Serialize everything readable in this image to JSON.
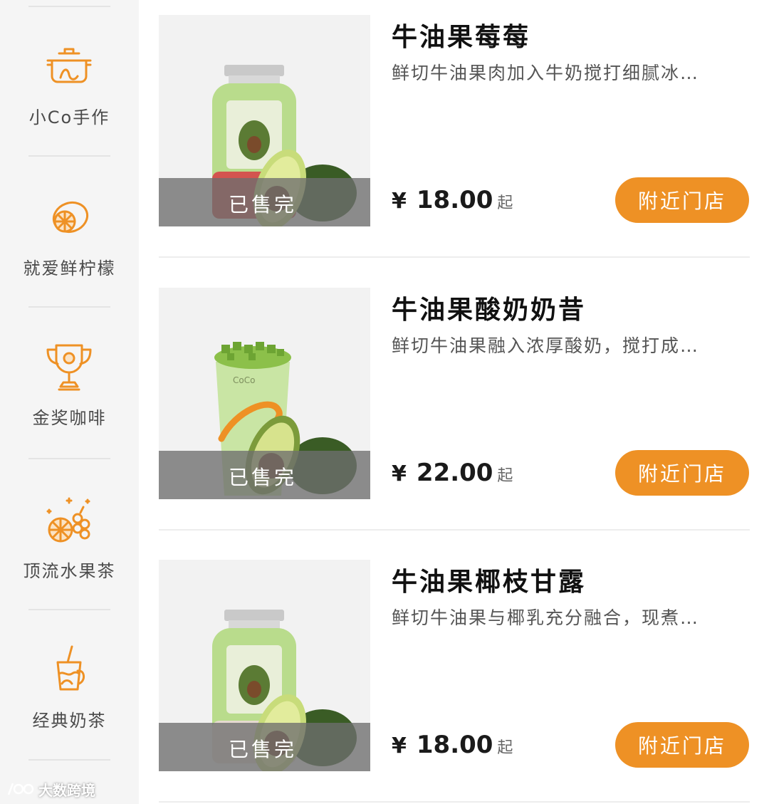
{
  "colors": {
    "accent": "#ee9125",
    "sidebar_bg": "#f5f5f5",
    "soldout_overlay": "#6e6e6e"
  },
  "sidebar": {
    "items": [
      {
        "label": "小Co手作",
        "icon": "pot-icon"
      },
      {
        "label": "就爱鲜柠檬",
        "icon": "lemon-icon"
      },
      {
        "label": "金奖咖啡",
        "icon": "trophy-icon"
      },
      {
        "label": "顶流水果茶",
        "icon": "fruit-icon"
      },
      {
        "label": "经典奶茶",
        "icon": "milk-tea-cup-icon"
      }
    ]
  },
  "watermark": "大数跨境",
  "products": [
    {
      "title": "牛油果莓莓",
      "desc": "鲜切牛油果肉加入牛奶搅打细腻冰…",
      "currency": "¥",
      "price": "18.00",
      "price_suffix": "起",
      "soldout_label": "已售完",
      "button_label": "附近门店",
      "image": "avocado-bottle"
    },
    {
      "title": "牛油果酸奶奶昔",
      "desc": "鲜切牛油果融入浓厚酸奶，搅打成…",
      "currency": "¥",
      "price": "22.00",
      "price_suffix": "起",
      "soldout_label": "已售完",
      "button_label": "附近门店",
      "image": "avocado-cup"
    },
    {
      "title": "牛油果椰枝甘露",
      "desc": "鲜切牛油果与椰乳充分融合，现煮…",
      "currency": "¥",
      "price": "18.00",
      "price_suffix": "起",
      "soldout_label": "已售完",
      "button_label": "附近门店",
      "image": "avocado-bottle"
    }
  ]
}
